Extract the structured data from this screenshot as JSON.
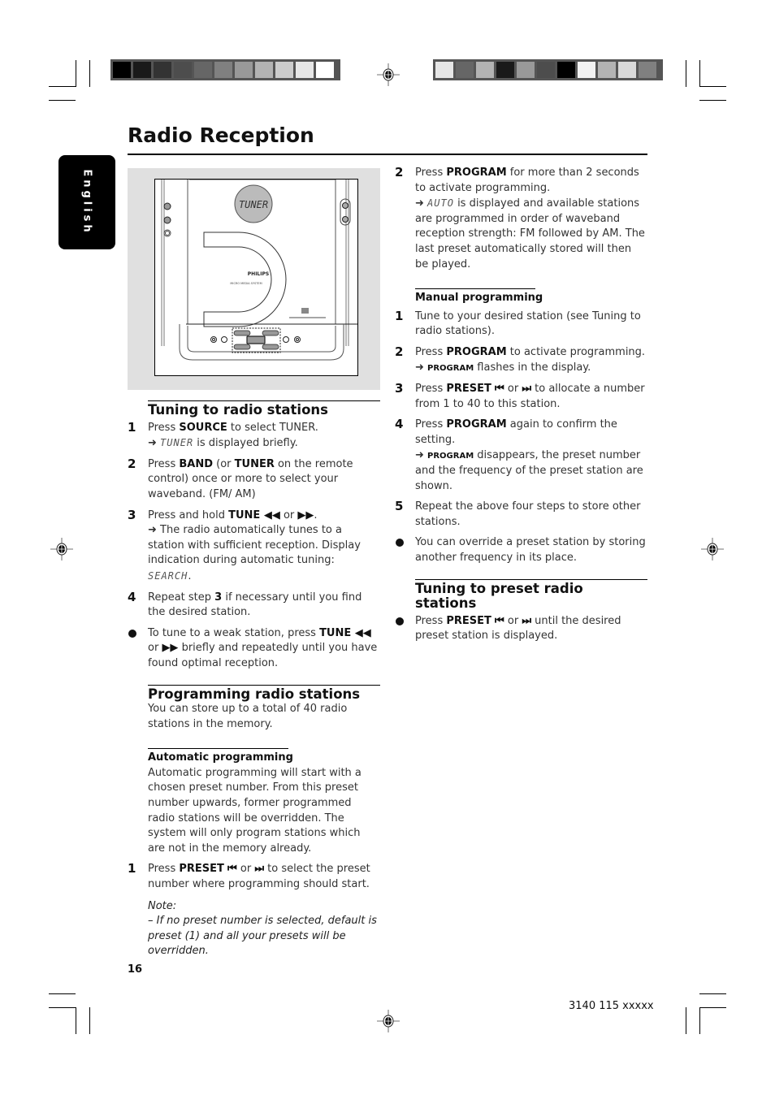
{
  "page": {
    "title": "Radio Reception",
    "language_tab": "English",
    "page_number": "16",
    "doc_code": "3140 115 xxxxx"
  },
  "color_bars": {
    "left": [
      "#000000",
      "#1a1a1a",
      "#333333",
      "#4d4d4d",
      "#666666",
      "#808080",
      "#999999",
      "#b3b3b3",
      "#cccccc",
      "#e6e6e6",
      "#ffffff"
    ],
    "right": [
      "#e6e6e6",
      "#666666",
      "#b3b3b3",
      "#1a1a1a",
      "#999999",
      "#4d4d4d",
      "#000000",
      "#f2f2f2",
      "#b3b3b3",
      "#d9d9d9",
      "#808080"
    ]
  },
  "figure": {
    "display_text": "TUNER",
    "brand": "PHILIPS",
    "model_text": "MICRO MEDIA SYSTEM"
  },
  "tuning": {
    "heading": "Tuning to radio stations",
    "steps": [
      {
        "num": "1",
        "html": "Press <b>SOURCE</b> to select TUNER.<br>➜ <span class=\"lcd\">TUNER</span> is displayed briefly."
      },
      {
        "num": "2",
        "html": "Press <b>BAND</b> (or <b>TUNER</b> on the remote control) once or more to select your waveband. (FM/ AM)"
      },
      {
        "num": "3",
        "html": "Press and hold <b>TUNE ◀◀</b> or <b>▶▶</b>.<br>➜ The radio automatically tunes to a station with sufficient reception. Display indication during automatic tuning: <span class=\"lcd\">SEARCH</span>."
      },
      {
        "num": "4",
        "html": "Repeat step <b>3</b> if necessary until you find the desired station."
      },
      {
        "num": "",
        "bullet": true,
        "html": "To tune to a weak station, press <b>TUNE ◀◀</b> or <b>▶▶</b> briefly and repeatedly until you have found optimal reception."
      }
    ]
  },
  "programming": {
    "heading": "Programming radio stations",
    "intro": "You can store up to a total of 40 radio stations in the memory.",
    "auto": {
      "heading": "Automatic programming",
      "intro": "Automatic programming will start with a chosen preset number. From this preset number upwards, former programmed radio stations will be overridden. The system will only program stations which are not in the memory already.",
      "steps": [
        {
          "num": "1",
          "html": "Press <b>PRESET</b> <b>⏮</b> or <b>⏭</b> to select the preset number where programming should start."
        }
      ],
      "note_label": "Note:",
      "note_text": "–  If no preset number is selected, default is preset (1) and all your presets will be overridden.",
      "steps_continued": [
        {
          "num": "2",
          "html": "Press <b>PROGRAM</b> for more than 2 seconds to activate programming.<br>➜ <span class=\"lcd\">AUTO</span> is displayed and available stations are programmed in order of waveband reception strength: FM followed by AM. The last preset automatically stored will then be played."
        }
      ]
    },
    "manual": {
      "heading": "Manual programming",
      "steps": [
        {
          "num": "1",
          "html": "Tune to your desired station (see Tuning to radio stations)."
        },
        {
          "num": "2",
          "html": "Press <b>PROGRAM</b> to activate programming.<br>➜ <span class=\"sc\">PROGRAM</span> flashes in the display."
        },
        {
          "num": "3",
          "html": "Press <b>PRESET</b> <b>⏮</b> or <b>⏭</b> to allocate a number from 1 to 40 to this station."
        },
        {
          "num": "4",
          "html": "Press <b>PROGRAM</b> again to confirm the setting.<br>➜ <span class=\"sc\">PROGRAM</span> disappears, the preset number and the frequency of the preset station are shown."
        },
        {
          "num": "5",
          "html": "Repeat the above four steps to store other stations."
        },
        {
          "num": "",
          "bullet": true,
          "html": "You can override a preset station by storing another frequency in its place."
        }
      ]
    }
  },
  "preset": {
    "heading": "Tuning to preset radio stations",
    "steps": [
      {
        "num": "",
        "bullet": true,
        "html": "Press <b>PRESET</b> <b>⏮</b> or <b>⏭</b> until the desired preset station is displayed."
      }
    ]
  }
}
